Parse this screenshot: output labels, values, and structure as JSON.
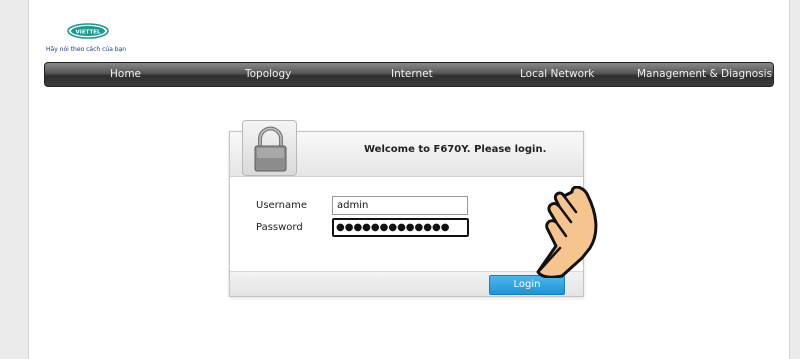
{
  "logo": {
    "brand": "VIETTEL",
    "tagline": "Hãy nói theo cách của bạn"
  },
  "nav": {
    "items": [
      {
        "label": "Home"
      },
      {
        "label": "Topology"
      },
      {
        "label": "Internet"
      },
      {
        "label": "Local Network"
      },
      {
        "label": "Management & Diagnosis"
      }
    ]
  },
  "login": {
    "title": "Welcome to F670Y. Please login.",
    "username_label": "Username",
    "username_value": "admin",
    "password_label": "Password",
    "password_value": "●●●●●●●●●●●●●",
    "button_label": "Login"
  },
  "colors": {
    "brand_green": "#1a9c8c",
    "button_blue": "#2aa3e2",
    "hand_fill": "#f6c48e"
  }
}
